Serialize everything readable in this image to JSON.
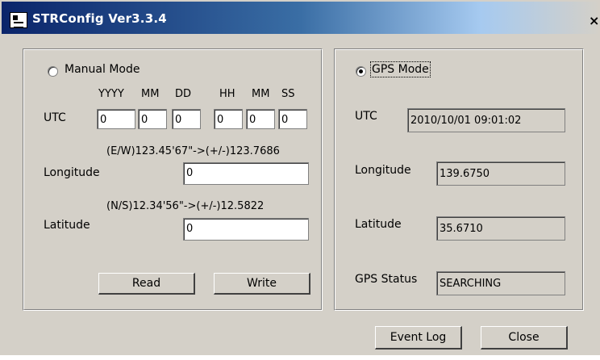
{
  "window": {
    "title": "STRConfig Ver3.3.4",
    "close_glyph": "×"
  },
  "manual": {
    "mode_label": "Manual Mode",
    "selected": false,
    "utc_label": "UTC",
    "utc_headers": [
      "YYYY",
      "MM",
      "DD",
      "HH",
      "MM",
      "SS"
    ],
    "utc_values": [
      "0",
      "0",
      "0",
      "0",
      "0",
      "0"
    ],
    "longitude_hint": "(E/W)123.45'67\"->(+/-)123.7686",
    "longitude_label": "Longitude",
    "longitude_value": "0",
    "latitude_hint": "(N/S)12.34'56\"->(+/-)12.5822",
    "latitude_label": "Latitude",
    "latitude_value": "0",
    "read_label": "Read",
    "write_label": "Write"
  },
  "gps": {
    "mode_label": "GPS Mode",
    "selected": true,
    "utc_label": "UTC",
    "utc_value": "2010/10/01 09:01:02",
    "longitude_label": "Longitude",
    "longitude_value": "139.6750",
    "latitude_label": "Latitude",
    "latitude_value": "35.6710",
    "status_label": "GPS Status",
    "status_value": "SEARCHING"
  },
  "footer": {
    "event_log_label": "Event Log",
    "close_label": "Close"
  }
}
